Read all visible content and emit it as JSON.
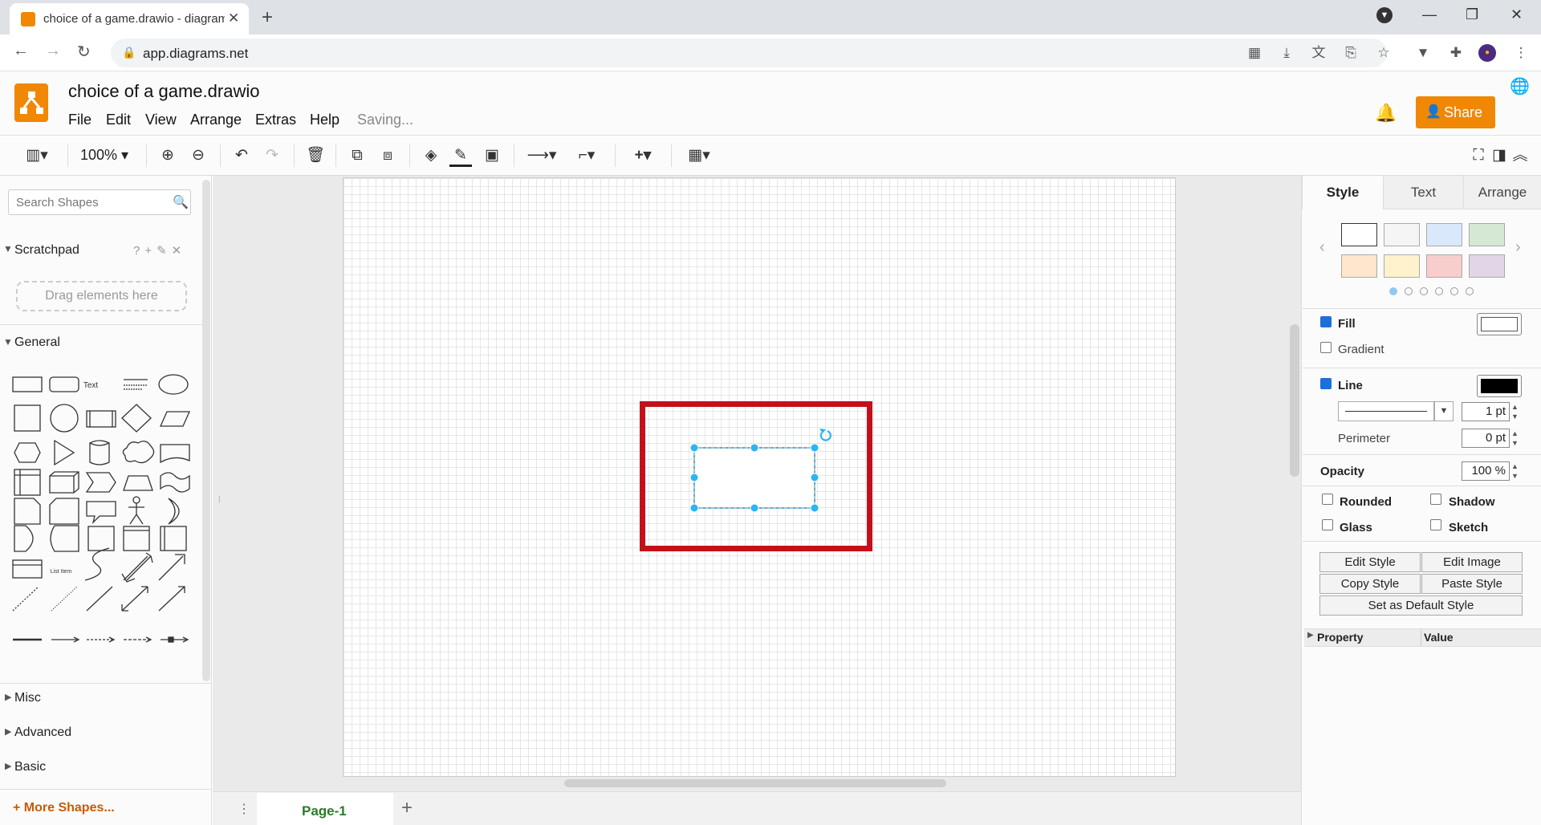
{
  "browser": {
    "tab_title": "choice of a game.drawio - diagrams.net",
    "url": "app.diagrams.net"
  },
  "app": {
    "doc_title": "choice of a game.drawio",
    "menus": [
      "File",
      "Edit",
      "View",
      "Arrange",
      "Extras",
      "Help"
    ],
    "status": "Saving...",
    "share_label": "Share",
    "accent": "#f08705"
  },
  "toolbar": {
    "zoom": "100%"
  },
  "left": {
    "search_placeholder": "Search Shapes",
    "scratchpad": "Scratchpad",
    "scratchpad_hint": "Drag elements here",
    "general": "General",
    "shape_text": "Text",
    "shape_list_item": "List Item",
    "sections": [
      "Misc",
      "Advanced",
      "Basic"
    ],
    "more_shapes": "+ More Shapes..."
  },
  "canvas": {
    "page_name": "Page-1",
    "selection_color": "#29b6f2",
    "highlight_color": "#c2111b"
  },
  "right": {
    "tabs": [
      "Style",
      "Text",
      "Arrange"
    ],
    "swatches": [
      "#ffffff",
      "#f5f5f5",
      "#dae8fc",
      "#d5e8d4",
      "#ffe6cc",
      "#fff2cc",
      "#f8cecc",
      "#e1d5e7"
    ],
    "fill": "Fill",
    "gradient": "Gradient",
    "line": "Line",
    "line_width": "1 pt",
    "perimeter": "Perimeter",
    "perimeter_value": "0 pt",
    "opacity": "Opacity",
    "opacity_value": "100 %",
    "rounded": "Rounded",
    "shadow": "Shadow",
    "glass": "Glass",
    "sketch": "Sketch",
    "edit_style": "Edit Style",
    "edit_image": "Edit Image",
    "copy_style": "Copy Style",
    "paste_style": "Paste Style",
    "set_default": "Set as Default Style",
    "property": "Property",
    "value": "Value"
  }
}
